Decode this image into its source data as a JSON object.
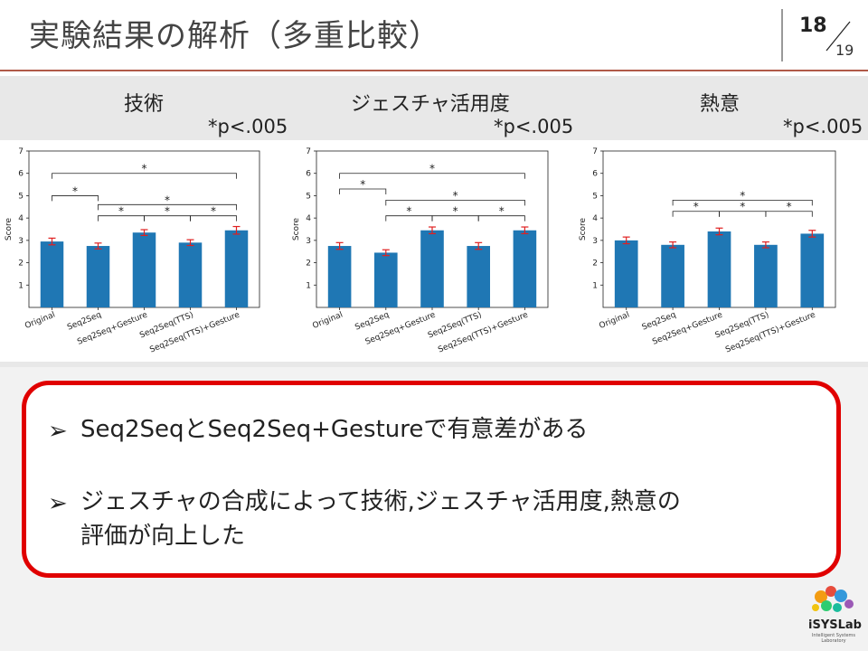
{
  "slide": {
    "title": "実験結果の解析（多重比較）",
    "page_number": "18",
    "page_total": "19"
  },
  "panels": [
    {
      "title": "技術",
      "sig": "*p<.005"
    },
    {
      "title": "ジェスチャ活用度",
      "sig": "*p<.005"
    },
    {
      "title": "熱意",
      "sig": "*p<.005"
    }
  ],
  "chart_data": [
    {
      "type": "bar",
      "categories": [
        "Original",
        "Seq2Seq",
        "Seq2Seq+Gesture",
        "Seq2Seq(TTS)",
        "Seq2Seq(TTS)+Gesture"
      ],
      "values": [
        2.95,
        2.75,
        3.35,
        2.9,
        3.45
      ],
      "errors": [
        0.15,
        0.13,
        0.13,
        0.13,
        0.17
      ],
      "ylabel": "Score",
      "ylim": [
        0,
        7
      ],
      "yticks": [
        1,
        2,
        3,
        4,
        5,
        6,
        7
      ],
      "color": "#1f77b4",
      "error_color": "#e02020",
      "comparisons": [
        [
          0,
          4,
          6.0
        ],
        [
          0,
          1,
          5.0
        ],
        [
          1,
          4,
          4.6
        ],
        [
          1,
          2,
          4.1
        ],
        [
          2,
          3,
          4.1
        ],
        [
          3,
          4,
          4.1
        ]
      ],
      "annotation": "*"
    },
    {
      "type": "bar",
      "categories": [
        "Original",
        "Seq2Seq",
        "Seq2Seq+Gesture",
        "Seq2Seq(TTS)",
        "Seq2Seq(TTS)+Gesture"
      ],
      "values": [
        2.75,
        2.45,
        3.45,
        2.75,
        3.45
      ],
      "errors": [
        0.15,
        0.13,
        0.15,
        0.15,
        0.15
      ],
      "ylabel": "Score",
      "ylim": [
        0,
        7
      ],
      "yticks": [
        1,
        2,
        3,
        4,
        5,
        6,
        7
      ],
      "color": "#1f77b4",
      "error_color": "#e02020",
      "comparisons": [
        [
          0,
          4,
          6.0
        ],
        [
          0,
          1,
          5.3
        ],
        [
          1,
          4,
          4.8
        ],
        [
          1,
          2,
          4.1
        ],
        [
          2,
          3,
          4.1
        ],
        [
          3,
          4,
          4.1
        ]
      ],
      "annotation": "*"
    },
    {
      "type": "bar",
      "categories": [
        "Original",
        "Seq2Seq",
        "Seq2Seq+Gesture",
        "Seq2Seq(TTS)",
        "Seq2Seq(TTS)+Gesture"
      ],
      "values": [
        3.0,
        2.8,
        3.4,
        2.8,
        3.3
      ],
      "errors": [
        0.15,
        0.13,
        0.15,
        0.13,
        0.15
      ],
      "ylabel": "Score",
      "ylim": [
        0,
        7
      ],
      "yticks": [
        1,
        2,
        3,
        4,
        5,
        6,
        7
      ],
      "color": "#1f77b4",
      "error_color": "#e02020",
      "comparisons": [
        [
          1,
          4,
          4.8
        ],
        [
          1,
          2,
          4.3
        ],
        [
          2,
          3,
          4.3
        ],
        [
          3,
          4,
          4.3
        ]
      ],
      "annotation": "*"
    }
  ],
  "callout": {
    "bullet_glyph": "➢",
    "items": [
      {
        "line1": "Seq2SeqとSeq2Seq+Gestureで有意差がある"
      },
      {
        "line1": "ジェスチャの合成によって技術,ジェスチャ活用度,熱意の",
        "line2": "評価が向上した"
      }
    ]
  },
  "logo": {
    "name": "iSYSLab",
    "sub": "Intelligent Systems Laboratory"
  }
}
